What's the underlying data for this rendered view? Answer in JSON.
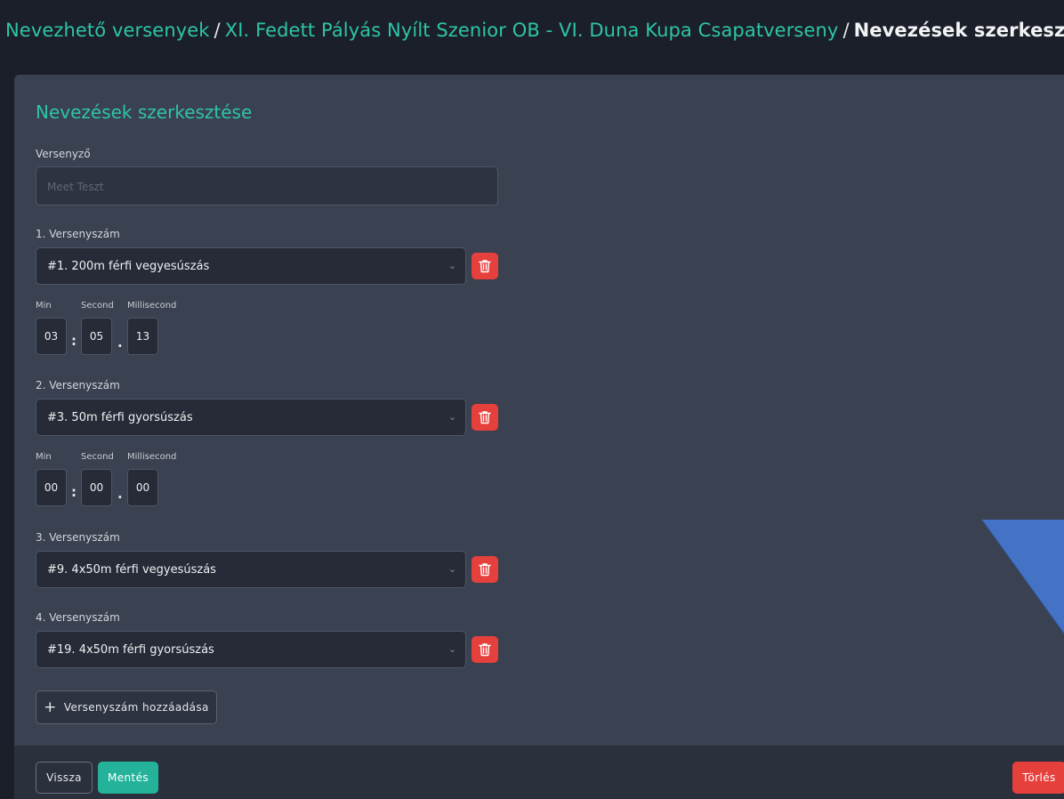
{
  "breadcrumb": {
    "items": [
      "Nevezhető versenyek",
      "XI. Fedett Pályás Nyílt Szenior OB - VI. Duna Kupa Csapatverseny",
      "Nevezések szerkesztése"
    ],
    "separator": "/"
  },
  "form": {
    "title": "Nevezések szerkesztése",
    "competitor_label": "Versenyző",
    "competitor_placeholder": "Meet Teszt",
    "time_labels": {
      "min": "Min",
      "second": "Second",
      "ms": "Millisecond"
    },
    "events": [
      {
        "label": "1. Versenyszám",
        "value": "#1. 200m férfi vegyesúszás",
        "time": [
          "03",
          "05",
          "13"
        ]
      },
      {
        "label": "2. Versenyszám",
        "value": "#3. 50m férfi gyorsúszás",
        "time": [
          "00",
          "00",
          "00"
        ]
      },
      {
        "label": "3. Versenyszám",
        "value": "#9. 4x50m férfi vegyesúszás"
      },
      {
        "label": "4. Versenyszám",
        "value": "#19. 4x50m férfi gyorsúszás"
      }
    ],
    "add_event_label": "Versenyszám hozzáadása"
  },
  "footer": {
    "back_label": "Vissza",
    "save_label": "Mentés",
    "delete_label": "Törlés"
  },
  "icons": {
    "trash": "trash-icon",
    "chevron": "chevron-down-icon",
    "plus": "plus-icon"
  },
  "colors": {
    "accent": "#2ec4a8",
    "danger": "#e6403c",
    "primary": "#24b39a",
    "annotation": "#4472c4"
  }
}
